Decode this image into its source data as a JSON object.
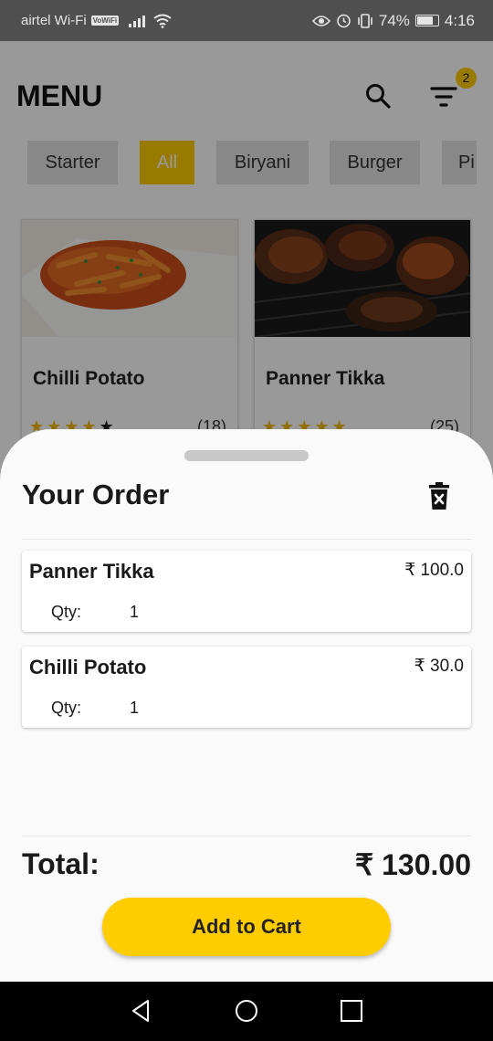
{
  "status_bar": {
    "carrier": "airtel Wi-Fi",
    "vowifi_badge": "VoWiFi",
    "battery": "74%",
    "time": "4:16",
    "icons": [
      "signal-icon",
      "wifi-icon",
      "eye-icon",
      "alarm-icon",
      "vibrate-icon",
      "battery-icon"
    ]
  },
  "header": {
    "title": "MENU",
    "search_icon": "search-icon",
    "filter_icon": "filter-icon",
    "filter_badge": "2",
    "accent_color": "#ffcc00"
  },
  "categories": [
    {
      "label": "Starter",
      "active": false
    },
    {
      "label": "All",
      "active": true
    },
    {
      "label": "Biryani",
      "active": false
    },
    {
      "label": "Burger",
      "active": false
    },
    {
      "label": "Pi",
      "active": false
    }
  ],
  "menu_items": [
    {
      "name": "Chilli Potato",
      "rating": 4.5,
      "reviews": "(18)"
    },
    {
      "name": "Panner Tikka",
      "rating": 5,
      "reviews": "(25)"
    }
  ],
  "order": {
    "title": "Your Order",
    "clear_icon": "trash-icon",
    "items": [
      {
        "name": "Panner Tikka",
        "price": "₹ 100.0",
        "qty_label": "Qty:",
        "qty": "1"
      },
      {
        "name": "Chilli Potato",
        "price": "₹ 30.0",
        "qty_label": "Qty:",
        "qty": "1"
      }
    ],
    "total_label": "Total:",
    "total_value": "₹ 130.00",
    "add_button": "Add to Cart"
  },
  "nav_bar": {
    "icons": [
      "back-icon",
      "home-icon",
      "recents-icon"
    ]
  }
}
